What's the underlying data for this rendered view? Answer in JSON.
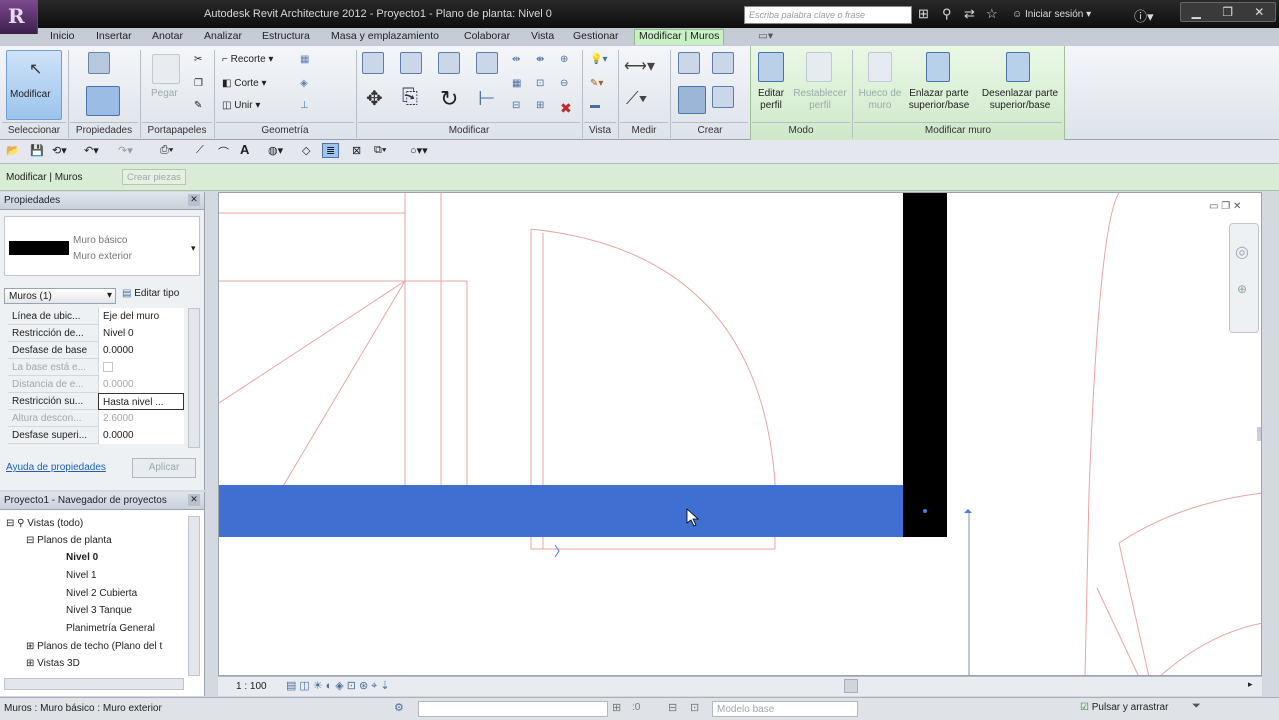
{
  "app": {
    "logo": "R",
    "title": "Autodesk Revit Architecture 2012 -    Proyecto1 - Plano de planta: Nivel 0"
  },
  "search": {
    "placeholder": "Escriba palabra clave o frase"
  },
  "login": {
    "label": "Iniciar sesión"
  },
  "tabs": [
    "Inicio",
    "Insertar",
    "Anotar",
    "Analizar",
    "Estructura",
    "Masa y emplazamiento",
    "Colaborar",
    "Vista",
    "Gestionar",
    "Modificar | Muros"
  ],
  "ribbon": {
    "modify_label": "Modificar",
    "panels": [
      "Seleccionar",
      "Propiedades",
      "Portapapeles",
      "Geometría",
      "Modificar",
      "Vista",
      "Medir",
      "Crear",
      "Modo",
      "Modificar muro"
    ],
    "paste": "Pegar",
    "geometry": {
      "cope": "Recorte",
      "cut": "Corte",
      "join": "Unir"
    },
    "mode": {
      "edit_profile": "Editar perfil",
      "reset_profile": "Restablecer perfil"
    },
    "wall": {
      "opening": "Hueco de muro",
      "attach": "Enlazar parte superior/base",
      "detach": "Desenlazar parte superior/base"
    }
  },
  "context": {
    "label": "Modificar | Muros",
    "create_parts": "Crear piezas"
  },
  "properties": {
    "title": "Propiedades",
    "type_name": "Muro básico",
    "type_sub": "Muro exterior",
    "selector": "Muros (1)",
    "edit_type": "Editar tipo",
    "rows": [
      {
        "k": "Línea de ubic...",
        "v": "Eje del muro"
      },
      {
        "k": "Restricción de...",
        "v": "Nivel 0"
      },
      {
        "k": "Desfase de base",
        "v": "0.0000"
      },
      {
        "k": "La base está e...",
        "v": ""
      },
      {
        "k": "Distancia de e...",
        "v": "0.0000"
      },
      {
        "k": "Restricción su...",
        "v": "Hasta nivel ..."
      },
      {
        "k": "Altura descon...",
        "v": "2.6000"
      },
      {
        "k": "Desfase superi...",
        "v": "0.0000"
      }
    ],
    "help": "Ayuda de propiedades",
    "apply": "Aplicar"
  },
  "browser": {
    "title": "Proyecto1 - Navegador de proyectos",
    "items": [
      "Vistas (todo)",
      "Planos de planta",
      "Nivel 0",
      "Nivel 1",
      "Nivel 2 Cubierta",
      "Nivel 3 Tanque",
      "Planimetría General",
      "Planos de techo (Plano del t",
      "Vistas 3D"
    ]
  },
  "viewbar": {
    "scale": "1 : 100"
  },
  "status": {
    "text": "Muros : Muro básico : Muro exterior",
    "model": "Modelo base",
    "press_drag": "Pulsar y arrastrar",
    "sel_count": ":0"
  },
  "colors": {
    "accent": "#3f6fd0",
    "active_tab": "#c9f0c5",
    "wall_black": "#000000"
  }
}
